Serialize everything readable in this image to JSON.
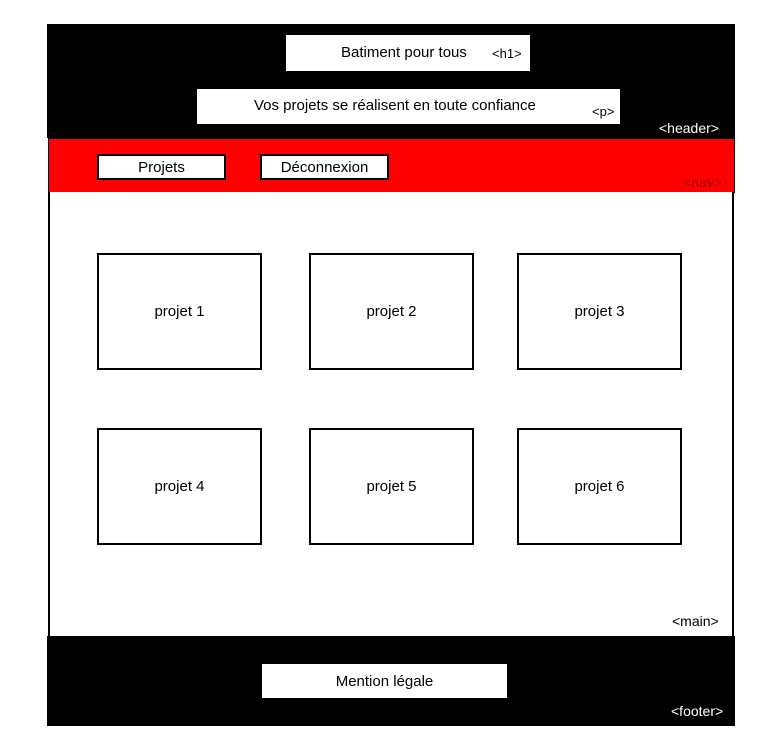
{
  "header": {
    "title": "Batiment pour tous",
    "title_tag": "<h1>",
    "subtitle": "Vos projets se réalisent en toute confiance",
    "subtitle_tag": "<p>",
    "region_tag": "<header>"
  },
  "nav": {
    "items": [
      {
        "label": "Projets"
      },
      {
        "label": "Déconnexion"
      }
    ],
    "region_tag": "<nav>"
  },
  "main": {
    "projects": [
      {
        "label": "projet 1"
      },
      {
        "label": "projet 2"
      },
      {
        "label": "projet 3"
      },
      {
        "label": "projet 4"
      },
      {
        "label": "projet 5"
      },
      {
        "label": "projet 6"
      }
    ],
    "region_tag": "<main>"
  },
  "footer": {
    "legal": "Mention légale",
    "region_tag": "<footer>"
  },
  "colors": {
    "header_bg": "#000000",
    "nav_bg": "#ff0000",
    "footer_bg": "#000000"
  }
}
